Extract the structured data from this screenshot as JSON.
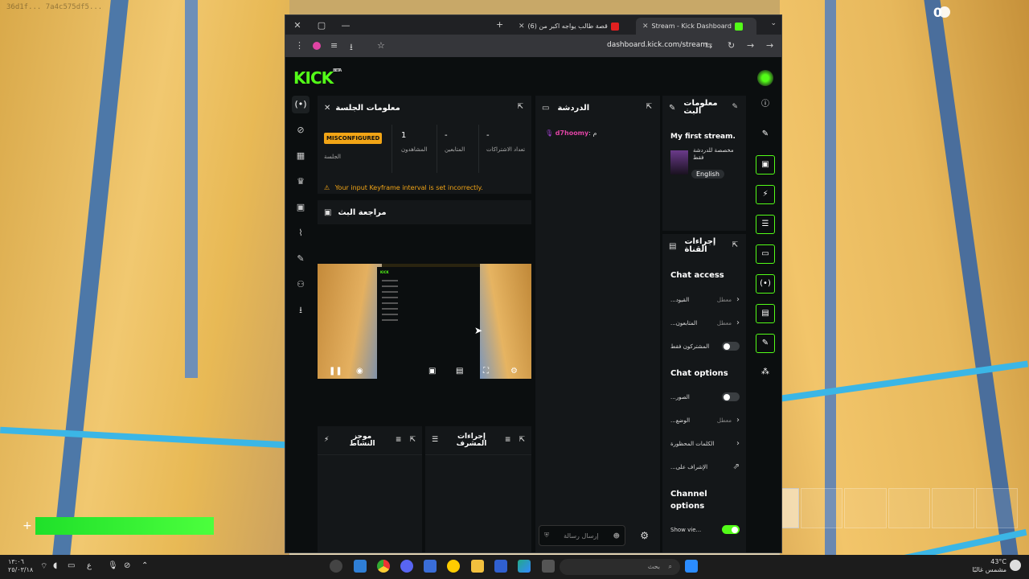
{
  "game": {
    "top_left_text": "36d1f... 7a4c575df5...",
    "top_right_count": "0",
    "health_plus": "+"
  },
  "browser": {
    "tabs": [
      {
        "label": "Stream - Kick Dashboard",
        "active": true
      },
      {
        "label": "(6) قصة طالب يواجه اكبر من",
        "active": false
      }
    ],
    "url": "dashboard.kick.com/stream",
    "new_tab": "+",
    "window_close": "✕",
    "window_max": "▢",
    "window_min": "—"
  },
  "kick": {
    "logo": "KICK",
    "logo_tag": "BETA",
    "session_panel": {
      "title": "معلومات الجلسة",
      "badge": "MISCONFIGURED",
      "session_label": "الجلسة",
      "stats": [
        {
          "value": "1",
          "label": "المشاهدون"
        },
        {
          "value": "-",
          "label": "المتابعين"
        },
        {
          "value": "-",
          "label": "تعداد الاشتراكات"
        }
      ],
      "warning": "Your input Keyframe interval is set incorrectly."
    },
    "review_panel": {
      "title": "مراجعة البث"
    },
    "activity_panel": {
      "title": "موجز النشاط"
    },
    "mod_panel": {
      "title": "إجراءات المشرف"
    },
    "chat_panel": {
      "title": "الدردشة",
      "messages": [
        {
          "user": "d7hoomy",
          "text": "م"
        }
      ],
      "input_placeholder": "إرسال رسالة"
    },
    "stream_info": {
      "title": "معلومات البث",
      "stream_title": "My first stream.",
      "category": "مخصصة للدردشة فقط",
      "language": "English"
    },
    "channel_actions": {
      "title": "إجراءات القناة",
      "chat_access_title": "Chat access",
      "chat_access": [
        {
          "label": "...القيود",
          "value": "معطل",
          "type": "chevron"
        },
        {
          "label": "...المتابعون",
          "value": "معطل",
          "type": "chevron"
        },
        {
          "label": "المشتركون فقط",
          "value": "",
          "type": "toggle",
          "on": false
        }
      ],
      "chat_options_title": "Chat options",
      "chat_options": [
        {
          "label": "...الصور",
          "value": "",
          "type": "toggle",
          "on": false
        },
        {
          "label": "...الوضع",
          "value": "معطل",
          "type": "chevron"
        },
        {
          "label": "الكلمات المحظورة",
          "value": "",
          "type": "chevron"
        },
        {
          "label": "...الإشراف على",
          "value": "",
          "type": "external"
        }
      ],
      "channel_options_title": "Channel options",
      "channel_options": [
        {
          "label": "Show vie...",
          "value": "",
          "type": "toggle",
          "on": true
        }
      ]
    }
  },
  "taskbar": {
    "time": "١٣:٠٦",
    "date": "٢٥/٠٣/١٨",
    "lang": "ع",
    "search": "بحث",
    "temp": "43°C",
    "weather": "مشمس غالبًا"
  },
  "colors": {
    "accent": "#53fc18",
    "warning": "#f2a516",
    "chat_user": "#e044a4"
  }
}
